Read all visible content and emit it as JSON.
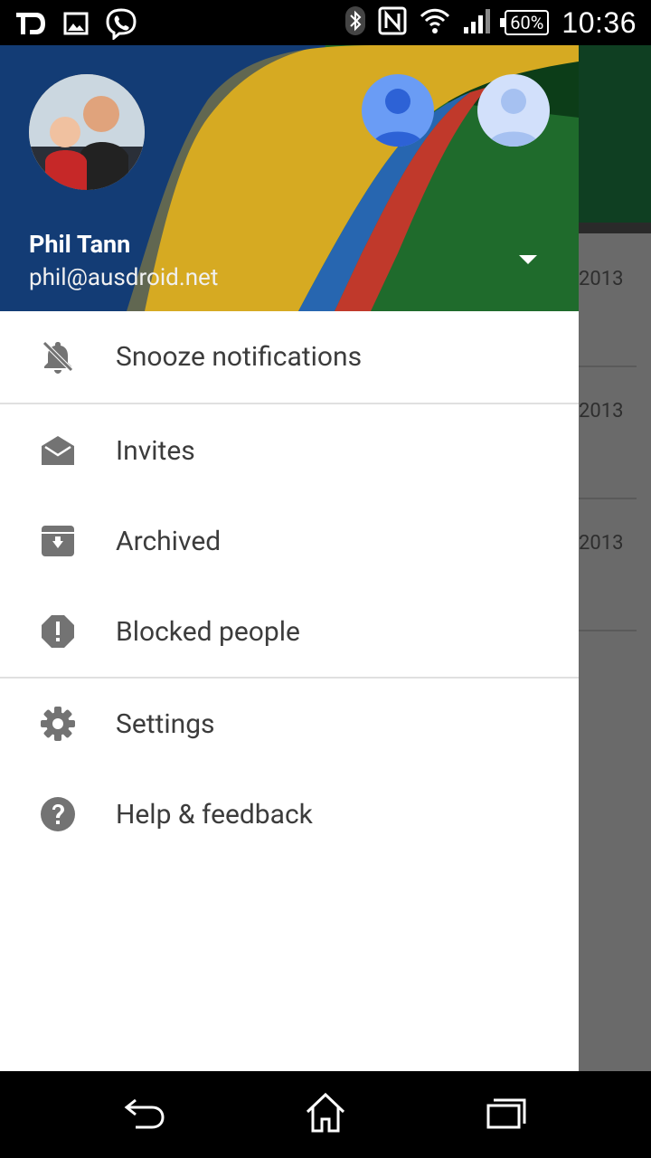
{
  "status_bar": {
    "left_icons": [
      "td-app-icon",
      "image-icon",
      "viber-icon"
    ],
    "right_icons": [
      "bluetooth-icon",
      "nfc-icon",
      "wifi-icon",
      "signal-icon"
    ],
    "battery": "60%",
    "time": "10:36"
  },
  "background_list": {
    "rows": [
      "2013",
      "2013",
      "2013"
    ]
  },
  "drawer": {
    "user_name": "Phil Tann",
    "user_email": "phil@ausdroid.net",
    "menu": [
      {
        "label": "Snooze notifications",
        "icon": "snooze-bell-icon"
      },
      {
        "label": "Invites",
        "icon": "envelope-open-icon"
      },
      {
        "label": "Archived",
        "icon": "archive-icon"
      },
      {
        "label": "Blocked people",
        "icon": "alert-octagon-icon"
      },
      {
        "label": "Settings",
        "icon": "gear-icon"
      },
      {
        "label": "Help & feedback",
        "icon": "help-icon"
      }
    ]
  },
  "nav_bar": [
    "back-icon",
    "home-icon",
    "recent-apps-icon"
  ],
  "colors": {
    "menu_icon": "#737373",
    "menu_text": "#3c3c3c",
    "header_blue": "#103a6a",
    "header_yellow": "#d6aa22",
    "header_red": "#c0392b",
    "header_green": "#1f6b2c",
    "avatar_blue": "#4a7fe8"
  }
}
